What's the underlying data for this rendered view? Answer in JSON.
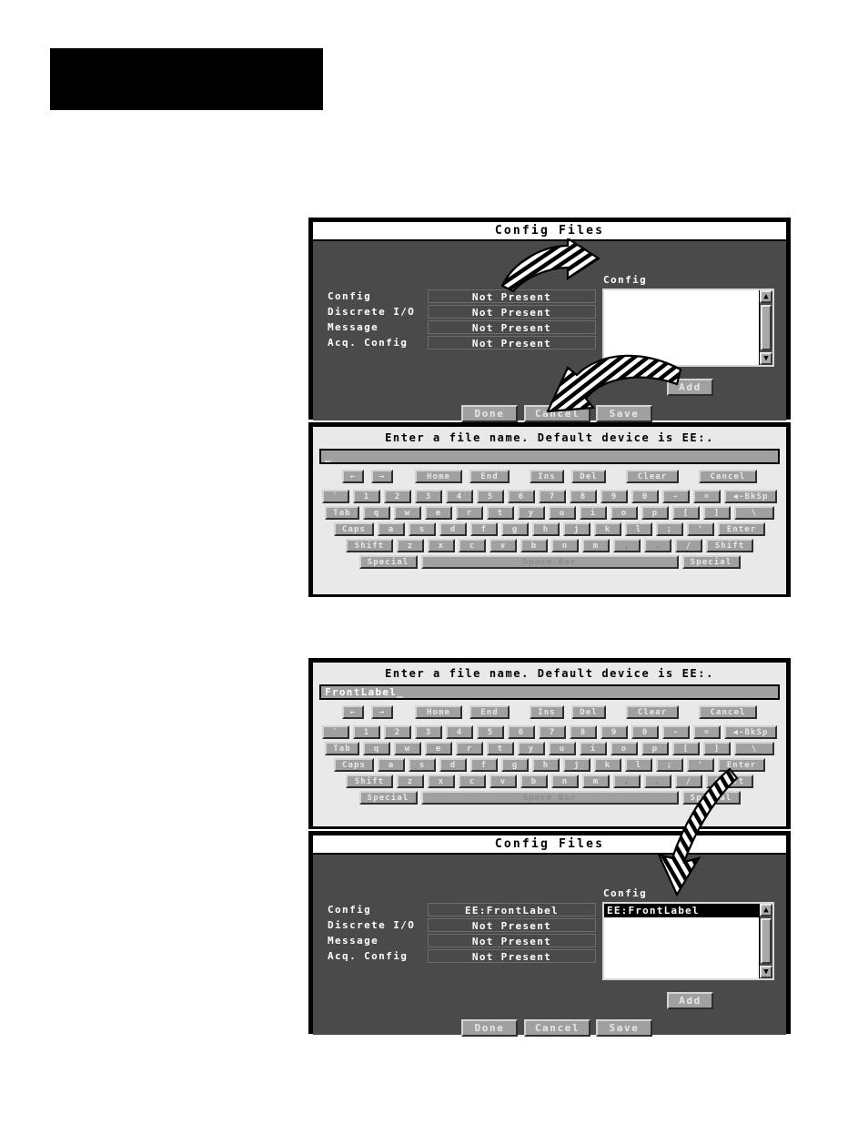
{
  "page": {
    "redacted_header": ""
  },
  "config_files_empty": {
    "title": "Config Files",
    "fields": [
      {
        "label": "Config",
        "value": "Not Present"
      },
      {
        "label": "Discrete I/O",
        "value": "Not Present"
      },
      {
        "label": "Message",
        "value": "Not Present"
      },
      {
        "label": "Acq. Config",
        "value": "Not Present"
      }
    ],
    "list_label": "Config",
    "list_items": [],
    "add_label": "Add",
    "buttons": [
      "Done",
      "Cancel",
      "Save"
    ],
    "scroll_up_icon": "up-arrow-icon",
    "scroll_down_icon": "down-arrow-icon"
  },
  "config_files_filled": {
    "title": "Config Files",
    "fields": [
      {
        "label": "Config",
        "value": "EE:FrontLabel"
      },
      {
        "label": "Discrete I/O",
        "value": "Not Present"
      },
      {
        "label": "Message",
        "value": "Not Present"
      },
      {
        "label": "Acq. Config",
        "value": "Not Present"
      }
    ],
    "list_label": "Config",
    "list_items": [
      "EE:FrontLabel"
    ],
    "add_label": "Add",
    "buttons": [
      "Done",
      "Cancel",
      "Save"
    ],
    "scroll_up_icon": "up-arrow-icon",
    "scroll_down_icon": "down-arrow-icon"
  },
  "keyboard_empty": {
    "prompt": "Enter a file name.  Default device is EE:.",
    "input_value": "_",
    "edit_keys": [
      "←",
      "→",
      "Home",
      "End",
      "Ins",
      "Del",
      "Clear",
      "Cancel"
    ],
    "row1": [
      "`",
      "1",
      "2",
      "3",
      "4",
      "5",
      "6",
      "7",
      "8",
      "9",
      "0",
      "-",
      "=",
      "◀-BkSp"
    ],
    "row2": [
      "Tab",
      "q",
      "w",
      "e",
      "r",
      "t",
      "y",
      "u",
      "i",
      "o",
      "p",
      "[",
      "]",
      "\\"
    ],
    "row3": [
      "Caps",
      "a",
      "s",
      "d",
      "f",
      "g",
      "h",
      "j",
      "k",
      "l",
      ";",
      "'",
      "Enter"
    ],
    "row4": [
      "Shift",
      "z",
      "x",
      "c",
      "v",
      "b",
      "n",
      "m",
      ",",
      ".",
      "/",
      "Shift"
    ],
    "row5": [
      "Special",
      "Space Bar",
      "Special"
    ]
  },
  "keyboard_filled": {
    "prompt": "Enter a file name.  Default device is EE:.",
    "input_value": "FrontLabel_",
    "edit_keys": [
      "←",
      "→",
      "Home",
      "End",
      "Ins",
      "Del",
      "Clear",
      "Cancel"
    ],
    "row1": [
      "`",
      "1",
      "2",
      "3",
      "4",
      "5",
      "6",
      "7",
      "8",
      "9",
      "0",
      "-",
      "=",
      "◀-BkSp"
    ],
    "row2": [
      "Tab",
      "q",
      "w",
      "e",
      "r",
      "t",
      "y",
      "u",
      "i",
      "o",
      "p",
      "[",
      "]",
      "\\"
    ],
    "row3": [
      "Caps",
      "a",
      "s",
      "d",
      "f",
      "g",
      "h",
      "j",
      "k",
      "l",
      ";",
      "'",
      "Enter"
    ],
    "row4": [
      "Shift",
      "z",
      "x",
      "c",
      "v",
      "b",
      "n",
      "m",
      ",",
      ".",
      "/",
      "Shift"
    ],
    "row5": [
      "Special",
      "Space Bar",
      "Special"
    ]
  },
  "annotations": {
    "arrow1": "callout-arrow-to-config-list",
    "arrow2": "callout-arrow-from-add-button",
    "arrow3": "callout-arrow-from-enter-key"
  },
  "colors": {
    "dialog_body": "#4a4a4a",
    "title_bar": "#ffffff",
    "button_face": "#a0a0a0",
    "keyboard_bg": "#e9e9e9",
    "selection": "#000000"
  }
}
